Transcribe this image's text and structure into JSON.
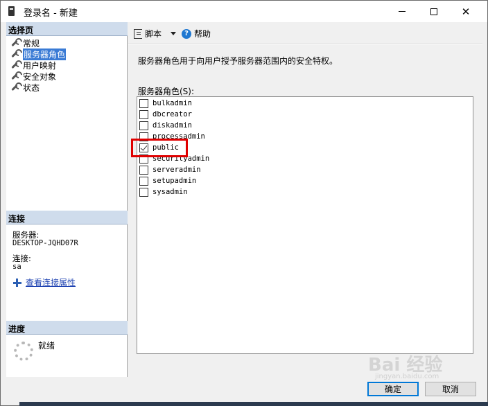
{
  "window": {
    "title": "登录名 - 新建",
    "close_glyph": "✕"
  },
  "left": {
    "select_page_header": "选择页",
    "nav_items": [
      {
        "label": "常规",
        "selected": false
      },
      {
        "label": "服务器角色",
        "selected": true
      },
      {
        "label": "用户映射",
        "selected": false
      },
      {
        "label": "安全对象",
        "selected": false
      },
      {
        "label": "状态",
        "selected": false
      }
    ],
    "connection_header": "连接",
    "server_label": "服务器:",
    "server_value": "DESKTOP-JQHD07R",
    "connection_label": "连接:",
    "connection_value": "sa",
    "view_properties_link": "查看连接属性",
    "progress_header": "进度",
    "progress_status": "就绪"
  },
  "toolbar": {
    "script_label": "脚本",
    "help_label": "帮助",
    "help_glyph": "?"
  },
  "content": {
    "description": "服务器角色用于向用户授予服务器范围内的安全特权。",
    "roles_label": "服务器角色(S):",
    "roles": [
      {
        "name": "bulkadmin",
        "checked": false
      },
      {
        "name": "dbcreator",
        "checked": false
      },
      {
        "name": "diskadmin",
        "checked": false
      },
      {
        "name": "processadmin",
        "checked": false
      },
      {
        "name": "public",
        "checked": true
      },
      {
        "name": "securityadmin",
        "checked": false
      },
      {
        "name": "serveradmin",
        "checked": false
      },
      {
        "name": "setupadmin",
        "checked": false
      },
      {
        "name": "sysadmin",
        "checked": false
      }
    ]
  },
  "footer": {
    "ok_label": "确定",
    "cancel_label": "取消"
  },
  "watermark": {
    "text": "Bai 经验",
    "sub": "jingyan.baidu.com"
  },
  "colors": {
    "highlight": "#e00000",
    "selection": "#3a7bd5",
    "section_header": "#cfdcec"
  }
}
